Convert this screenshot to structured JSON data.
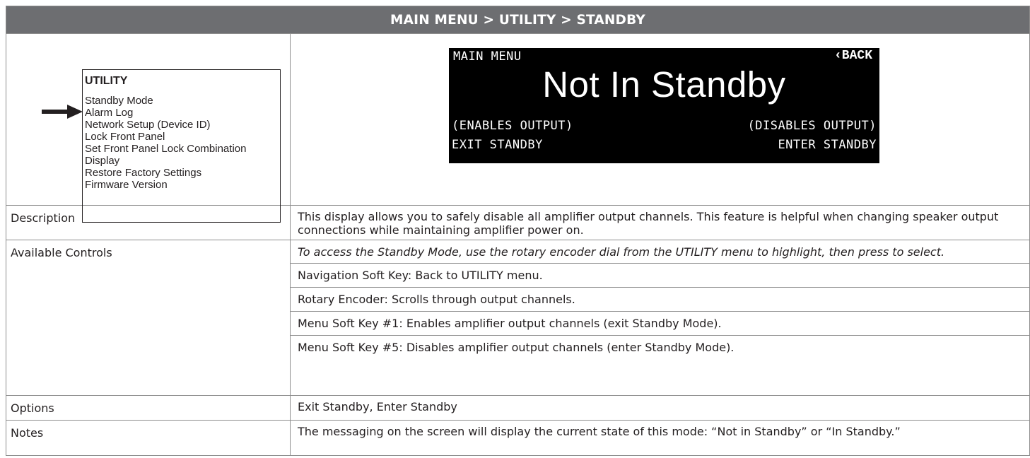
{
  "header": {
    "breadcrumb": "MAIN MENU > UTILITY > STANDBY"
  },
  "menu": {
    "title": "UTILITY",
    "items": [
      "Standby Mode",
      "Alarm Log",
      "Network Setup (Device ID)",
      "Lock Front Panel",
      "Set Front Panel Lock Combination",
      "Display",
      "Restore Factory Settings",
      "Firmware Version"
    ],
    "selected_index": 0
  },
  "lcd": {
    "main_menu": "MAIN MENU",
    "back": "‹BACK",
    "status": "Not In Standby",
    "left_hint": "(ENABLES OUTPUT)",
    "right_hint": "(DISABLES OUTPUT)",
    "left_action": "EXIT STANDBY",
    "right_action": "ENTER STANDBY"
  },
  "rows": {
    "description": {
      "label": "Description",
      "text": "This display allows you to safely disable all amplifier output channels. This feature is helpful when changing speaker output connections while maintaining amplifier power on."
    },
    "controls": {
      "label": "Available Controls",
      "items": [
        "To access the Standby Mode, use the rotary encoder dial from the UTILITY menu to highlight, then press to select.",
        "Navigation Soft Key: Back to UTILITY menu.",
        "Rotary Encoder: Scrolls through output channels.",
        "Menu Soft Key #1: Enables amplifier output channels (exit Standby Mode).",
        "Menu Soft Key #5: Disables amplifier output channels (enter Standby Mode)."
      ]
    },
    "options": {
      "label": "Options",
      "text": "Exit Standby, Enter Standby"
    },
    "notes": {
      "label": "Notes",
      "text": "The messaging on the screen will display the current state of this mode: “Not in Standby” or “In Standby.”"
    }
  }
}
